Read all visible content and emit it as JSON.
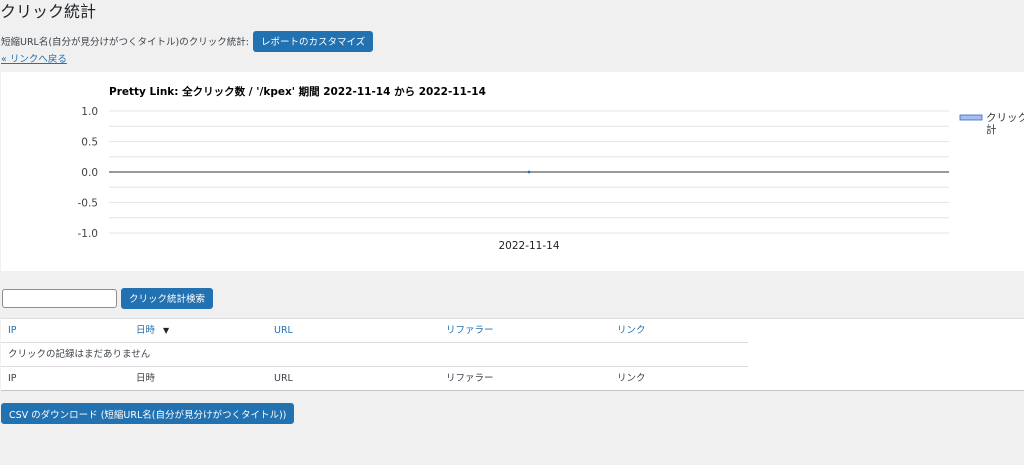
{
  "page": {
    "title": "クリック統計",
    "subtitle": "短縮URL名(自分が見分けがつくタイトル)のクリック統計:",
    "customize_label": "レポートのカスタマイズ",
    "back_link": "« リンクへ戻る"
  },
  "chart_data": {
    "type": "line",
    "title": "Pretty Link: 全クリック数 / '/kpex' 期間 2022-11-14 から 2022-11-14",
    "categories": [
      "2022-11-14"
    ],
    "series": [
      {
        "name": "クリック合計",
        "values": [
          0
        ]
      }
    ],
    "ylim": [
      -1.0,
      1.0
    ],
    "yticks": [
      "1.0",
      "0.5",
      "0.0",
      "-0.5",
      "-1.0"
    ],
    "legend_position": "right",
    "legend_lines": [
      "クリック",
      "計"
    ],
    "series_color": "#3366cc",
    "grid": true
  },
  "search": {
    "value": "",
    "button_label": "クリック統計検索"
  },
  "table": {
    "headers": [
      "IP",
      "日時",
      "URL",
      "リファラー",
      "リンク"
    ],
    "sort_indicator": "▼",
    "empty_message": "クリックの記録はまだありません",
    "footers": [
      "IP",
      "日時",
      "URL",
      "リファラー",
      "リンク"
    ]
  },
  "csv": {
    "button_label": "CSV のダウンロード (短縮URL名(自分が見分けがつくタイトル))"
  },
  "colors": {
    "accent": "#2271b1",
    "background": "#f0f0f1"
  }
}
